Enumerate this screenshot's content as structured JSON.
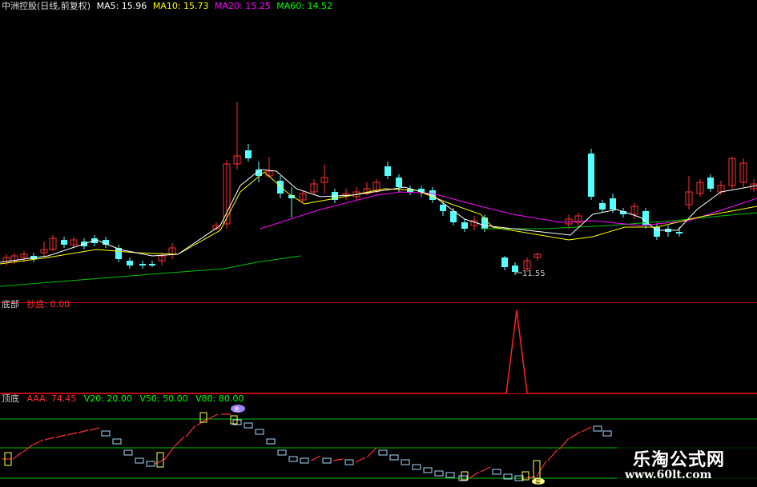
{
  "header": {
    "title": "中洲控股(日线,前复权)",
    "ma5": "MA5: 15.96",
    "ma10": "MA10: 15.73",
    "ma20": "MA20: 15.25",
    "ma60": "MA60: 14.52"
  },
  "price_panel": {
    "low_label": "11.55"
  },
  "panel2": {
    "name": "底部",
    "indicator": "抄底: 0.00"
  },
  "panel3": {
    "name": "顶底",
    "aaa": "AAA: 74.45",
    "v20": "V20: 20.00",
    "v50": "V50: 50.00",
    "v80": "V80: 80.00",
    "marker_top": "卖",
    "marker_bottom": "买"
  },
  "watermark": {
    "line1": "乐淘公式网",
    "line2": "www.60lt.com"
  },
  "colors": {
    "up": "#ff3030",
    "down": "#54ffff",
    "ma5": "#ffffff",
    "ma10": "#ffff00",
    "ma20": "#ff00ff",
    "ma60": "#00c000",
    "separator": "#c00000"
  }
}
